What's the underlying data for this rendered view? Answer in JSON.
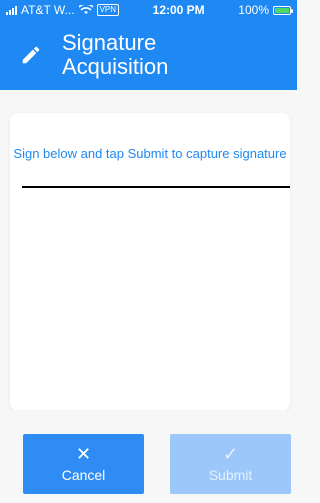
{
  "status_bar": {
    "carrier": "AT&T W...",
    "vpn": "VPN",
    "time": "12:00 PM",
    "battery": "100%",
    "battery_level": 1.0
  },
  "header": {
    "title": "Signature Acquisition"
  },
  "card": {
    "instruction": "Sign below and tap Submit to capture signature"
  },
  "buttons": {
    "cancel": {
      "icon": "✕",
      "label": "Cancel"
    },
    "submit": {
      "icon": "✓",
      "label": "Submit"
    }
  }
}
